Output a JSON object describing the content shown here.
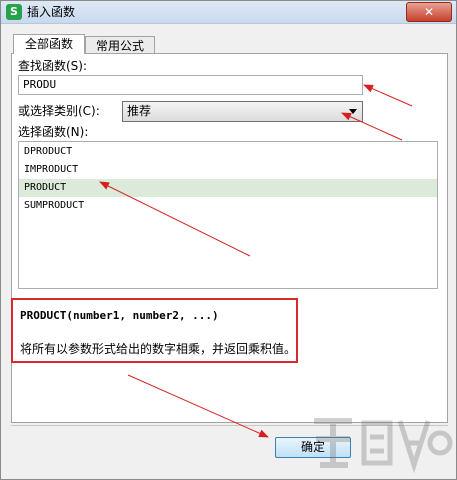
{
  "window": {
    "title": "插入函数",
    "app_icon_letter": "S",
    "close_label": "✕"
  },
  "tabs": [
    {
      "label": "全部函数",
      "active": true
    },
    {
      "label": "常用公式",
      "active": false
    }
  ],
  "search": {
    "label": "查找函数(S):",
    "value": "PRODU"
  },
  "category": {
    "label": "或选择类别(C):",
    "selected": "推荐"
  },
  "function_list": {
    "label": "选择函数(N):",
    "items": [
      "DPRODUCT",
      "IMPRODUCT",
      "PRODUCT",
      "SUMPRODUCT"
    ],
    "selected_index": 2
  },
  "description": {
    "signature": "PRODUCT(number1, number2, ...)",
    "text": "将所有以参数形式给出的数字相乘，并返回乘积值。"
  },
  "buttons": {
    "ok_label": "确定"
  },
  "colors": {
    "highlight_red": "#d72b2b",
    "selection_green": "#dcebd9",
    "arrow_red": "#d62020"
  }
}
